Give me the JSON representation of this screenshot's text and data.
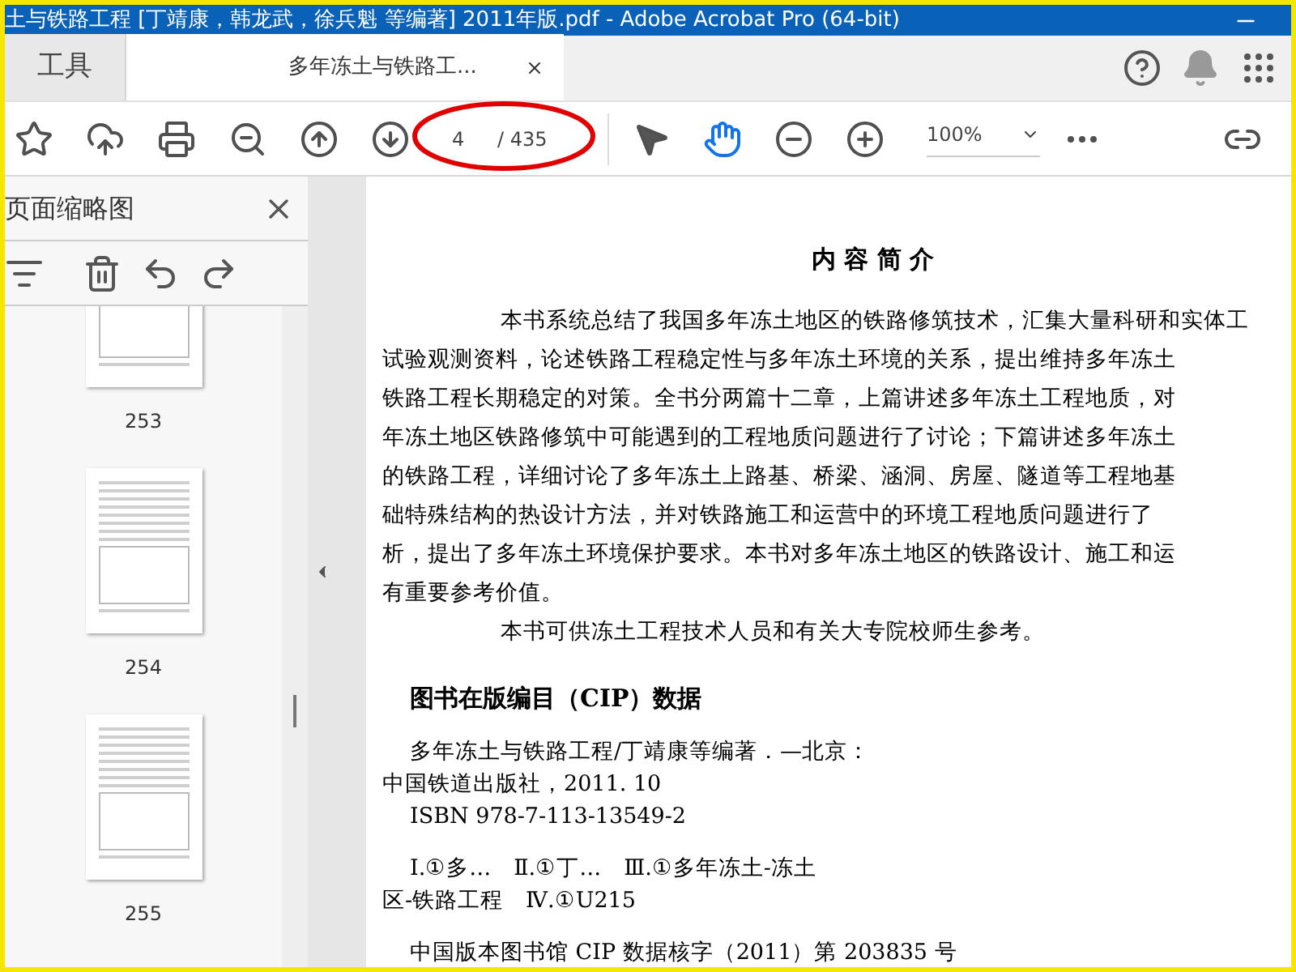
{
  "window": {
    "title": "土与铁路工程 [丁靖康，韩龙武，徐兵魁 等编著] 2011年版.pdf - Adobe Acrobat Pro (64-bit)"
  },
  "tabs": [
    {
      "label": "工具",
      "selected": false
    },
    {
      "label": "多年冻土与铁路工...",
      "selected": true
    }
  ],
  "toolbar": {
    "page_input": "4",
    "page_total": "/ 435",
    "zoom": "100%"
  },
  "sidebar": {
    "title": "页面缩略图",
    "thumbnails": [
      {
        "page": "253"
      },
      {
        "page": "254"
      },
      {
        "page": "255"
      }
    ]
  },
  "document": {
    "heading": "内 容 简 介",
    "intro_lines": [
      {
        "text": "本书系统总结了我国多年冻土地区的铁路修筑技术，汇集大量科研和实体工",
        "indent": true
      },
      {
        "text": "试验观测资料，论述铁路工程稳定性与多年冻土环境的关系，提出维持多年冻土",
        "indent": false
      },
      {
        "text": "铁路工程长期稳定的对策。全书分两篇十二章，上篇讲述多年冻土工程地质，对",
        "indent": false
      },
      {
        "text": "年冻土地区铁路修筑中可能遇到的工程地质问题进行了讨论；下篇讲述多年冻土",
        "indent": false
      },
      {
        "text": "的铁路工程，详细讨论了多年冻土上路基、桥梁、涵洞、房屋、隧道等工程地基",
        "indent": false
      },
      {
        "text": "础特殊结构的热设计方法，并对铁路施工和运营中的环境工程地质问题进行了",
        "indent": false
      },
      {
        "text": "析，提出了多年冻土环境保护要求。本书对多年冻土地区的铁路设计、施工和运",
        "indent": false
      },
      {
        "text": "有重要参考价值。",
        "indent": false
      },
      {
        "text": "本书可供冻土工程技术人员和有关大专院校师生参考。",
        "indent": true
      }
    ],
    "cip_heading": "图书在版编目（CIP）数据",
    "cip_lines": [
      {
        "text": "多年冻土与铁路工程/丁靖康等编著．—北京：",
        "indent": true,
        "space_before": false
      },
      {
        "text": "中国铁道出版社，2011. 10",
        "indent": false,
        "space_before": false
      },
      {
        "text": "ISBN 978-7-113-13549-2",
        "indent": true,
        "space_before": false
      },
      {
        "text": "Ⅰ.①多…　Ⅱ.①丁…　Ⅲ.①多年冻土-冻土",
        "indent": true,
        "space_before": true
      },
      {
        "text": "区-铁路工程　Ⅳ.①U215",
        "indent": false,
        "space_before": false
      },
      {
        "text": "中国版本图书馆 CIP 数据核字（2011）第 203835 号",
        "indent": true,
        "space_before": true
      }
    ]
  }
}
